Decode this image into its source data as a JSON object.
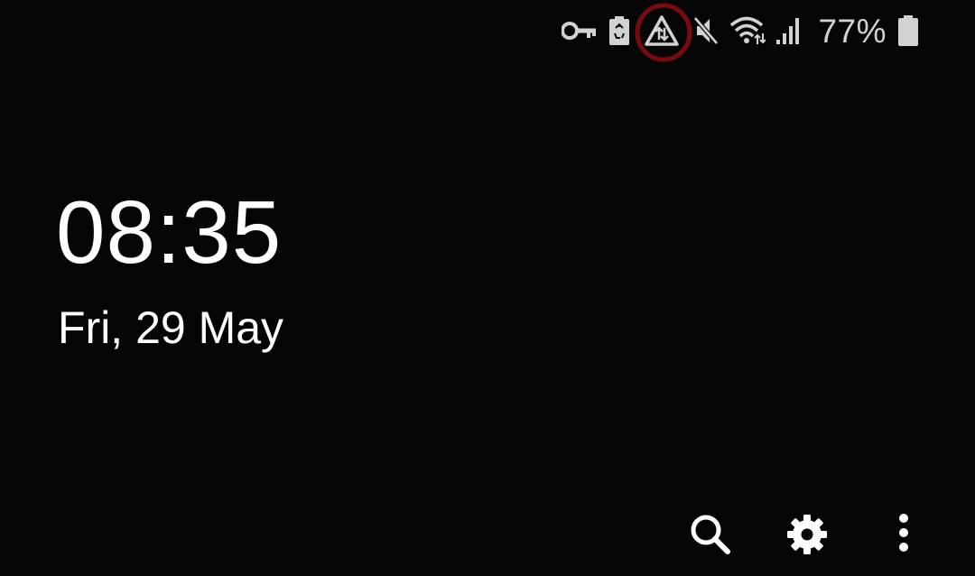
{
  "status_bar": {
    "icons": [
      {
        "name": "vpn-key-icon"
      },
      {
        "name": "battery-saver-icon"
      },
      {
        "name": "data-saver-icon",
        "highlighted": true
      },
      {
        "name": "mute-icon"
      },
      {
        "name": "wifi-icon"
      },
      {
        "name": "signal-icon"
      }
    ],
    "battery_percent": "77%",
    "battery_icon": "battery-icon",
    "highlight_color": "#7a0a10"
  },
  "clock": {
    "time": "08:35",
    "date": "Fri, 29 May"
  },
  "actions": [
    {
      "name": "search-icon"
    },
    {
      "name": "settings-gear-icon"
    },
    {
      "name": "more-vert-icon"
    }
  ],
  "colors": {
    "background": "#050505",
    "text": "#ffffff",
    "status_icons": "#d2d2d2"
  }
}
